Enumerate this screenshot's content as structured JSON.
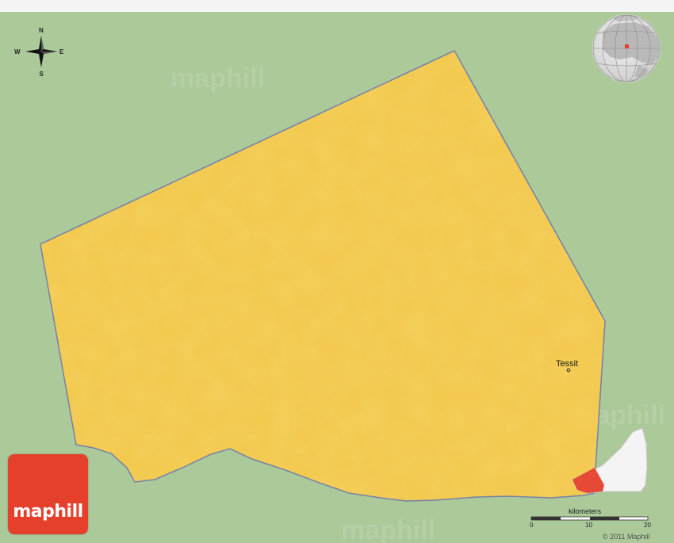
{
  "map": {
    "places": [
      {
        "name": "Tessit"
      }
    ],
    "compass": {
      "north": "N",
      "south": "S",
      "east": "E",
      "west": "W"
    },
    "scale_bar": {
      "title": "kilometers",
      "ticks": [
        "0",
        "10",
        "20"
      ]
    },
    "copyright": "© 2011 Maphill",
    "watermark": "maphill",
    "logo_text": "maphill",
    "colors": {
      "background_land": "#acc99a",
      "region_fill": "#f2c84b",
      "region_border": "#6d7aa8",
      "highlight": "#e5402b",
      "logo": "#e5402b"
    }
  }
}
